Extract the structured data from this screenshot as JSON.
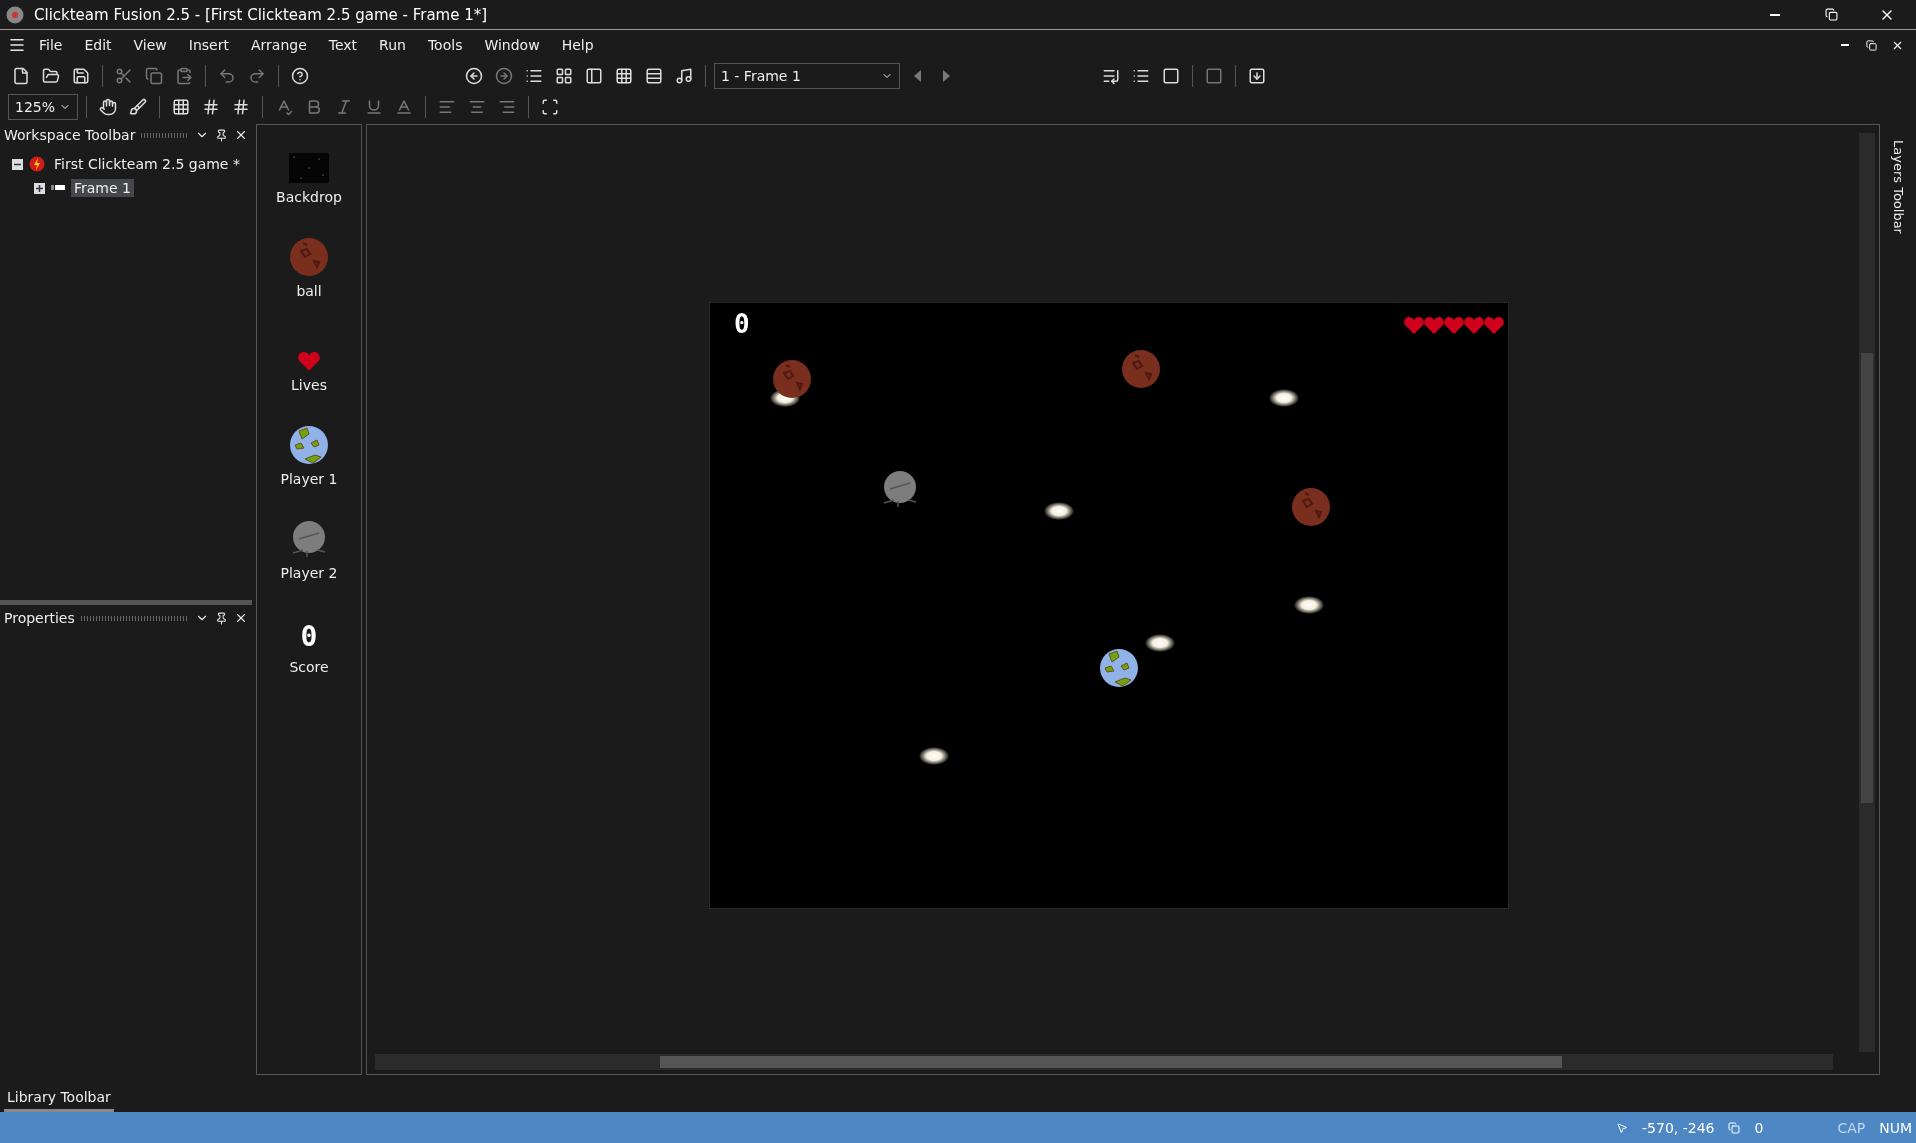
{
  "window": {
    "title": "Clickteam Fusion 2.5 - [First Clickteam 2.5 game - Frame 1*]"
  },
  "menu": [
    "File",
    "Edit",
    "View",
    "Insert",
    "Arrange",
    "Text",
    "Run",
    "Tools",
    "Window",
    "Help"
  ],
  "toolbar": {
    "frame_select": "1 - Frame 1",
    "zoom": "125%"
  },
  "workspace": {
    "title": "Workspace Toolbar",
    "tree": [
      {
        "label": "First Clickteam 2.5 game *",
        "expanded": true,
        "selected": false,
        "children": [
          {
            "label": "Frame 1",
            "expanded": false,
            "selected": true
          }
        ]
      }
    ]
  },
  "properties": {
    "title": "Properties"
  },
  "library": {
    "title": "Library Toolbar"
  },
  "objects": [
    {
      "kind": "backdrop",
      "name": "Backdrop"
    },
    {
      "kind": "ball",
      "name": "ball"
    },
    {
      "kind": "lives",
      "name": "Lives"
    },
    {
      "kind": "player1",
      "name": "Player 1"
    },
    {
      "kind": "player2",
      "name": "Player 2"
    },
    {
      "kind": "score",
      "name": "Score",
      "value": "0"
    }
  ],
  "frame": {
    "score": "0"
  },
  "layers": {
    "title": "Layers Toolbar"
  },
  "status_bar": {
    "coords": "-570, -246",
    "count": "0",
    "indicators": [
      {
        "label": "CAP",
        "on": false
      },
      {
        "label": "NUM",
        "on": true
      }
    ]
  }
}
